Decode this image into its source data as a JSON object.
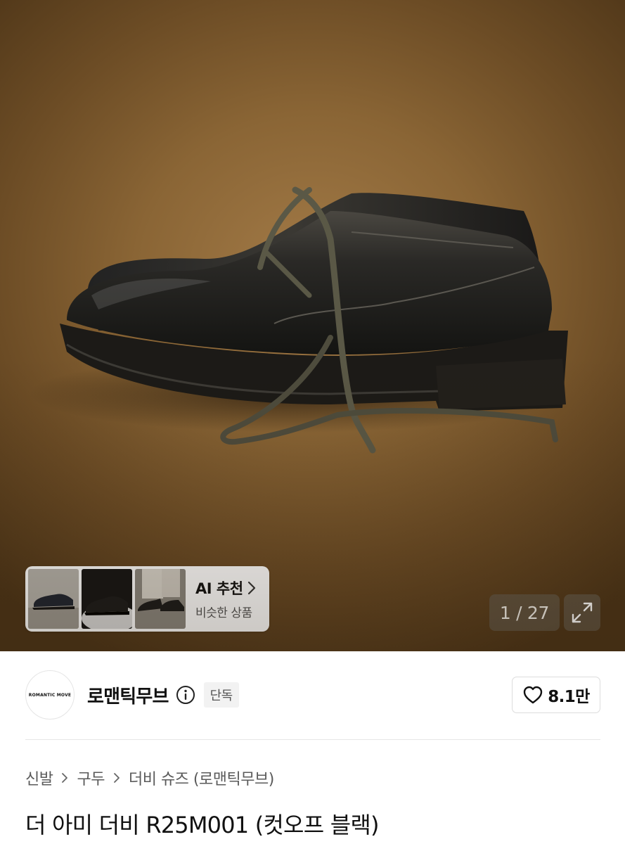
{
  "hero": {
    "alt": "더 아미 더비 R25M001 (컷오프 블랙)",
    "counter": "1 / 27"
  },
  "ai_recommend": {
    "title": "AI 추천",
    "subtitle": "비슷한 상품"
  },
  "brand": {
    "logo_text": "ROMANTIC MOVE",
    "name": "로맨틱무브",
    "badge": "단독"
  },
  "like": {
    "count": "8.1만"
  },
  "breadcrumb": [
    "신발",
    "구두",
    "더비 슈즈 (로맨틱무브)"
  ],
  "product": {
    "title": "더 아미 더비 R25M001 (컷오프 블랙)"
  },
  "colors": {
    "hero_bg": "#8a6535",
    "leather": "#1c1b19",
    "lace": "#5a5846"
  }
}
